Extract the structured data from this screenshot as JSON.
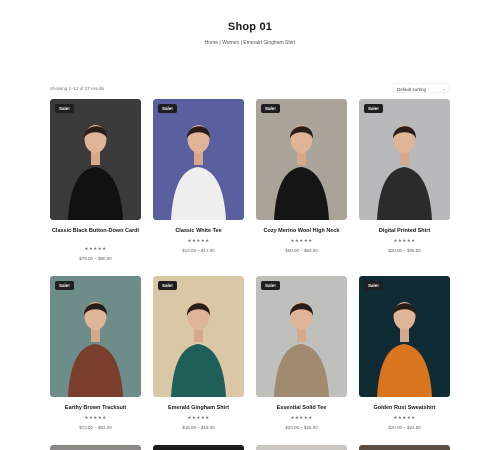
{
  "page": {
    "title": "Shop 01"
  },
  "breadcrumb": {
    "items": [
      "Home",
      "Women",
      "Emerald Gingham Shirt"
    ],
    "separator": "|"
  },
  "toolbar": {
    "result_count": "Showing 1–12 of 37 results",
    "sorting_label": "Default sorting"
  },
  "colors": {
    "badge": "#1f1f1f",
    "accent": "#1a1a1a"
  },
  "products": [
    {
      "badge": "Sale!",
      "name": "Classic Black Button-Down Cardi",
      "rating": "★★★★★",
      "price": "$79.00 – $80.00",
      "bg": "#3a3a3a"
    },
    {
      "badge": "Sale!",
      "name": "Classic White Tee",
      "rating": "★★★★★",
      "price": "$14.00 – $17.00",
      "bg": "#5a5fa0"
    },
    {
      "badge": "Sale!",
      "name": "Cozy Merino Wool High Neck",
      "rating": "★★★★★",
      "price": "$60.00 – $65.00",
      "bg": "#aaa39a"
    },
    {
      "badge": "Sale!",
      "name": "Digital Printed Shirt",
      "rating": "★★★★★",
      "price": "$20.00 – $35.00",
      "bg": "#b8b9bb"
    },
    {
      "badge": "Sale!",
      "name": "Earthy Brown Tracksuit",
      "rating": "★★★★★",
      "price": "$72.00 – $81.00",
      "bg": "#6e8c8a"
    },
    {
      "badge": "Sale!",
      "name": "Emerald Gingham Shirt",
      "rating": "★★★★★",
      "price": "$15.00 – $18.00",
      "bg": "#d9c7a6"
    },
    {
      "badge": "Sale!",
      "name": "Essential Solid Tee",
      "rating": "★★★★★",
      "price": "$20.00 – $25.00",
      "bg": "#bfbfbc"
    },
    {
      "badge": "Sale!",
      "name": "Golden Rust Sweatshirt",
      "rating": "★★★★★",
      "price": "$20.00 – $24.00",
      "bg": "#0f2b33"
    }
  ]
}
